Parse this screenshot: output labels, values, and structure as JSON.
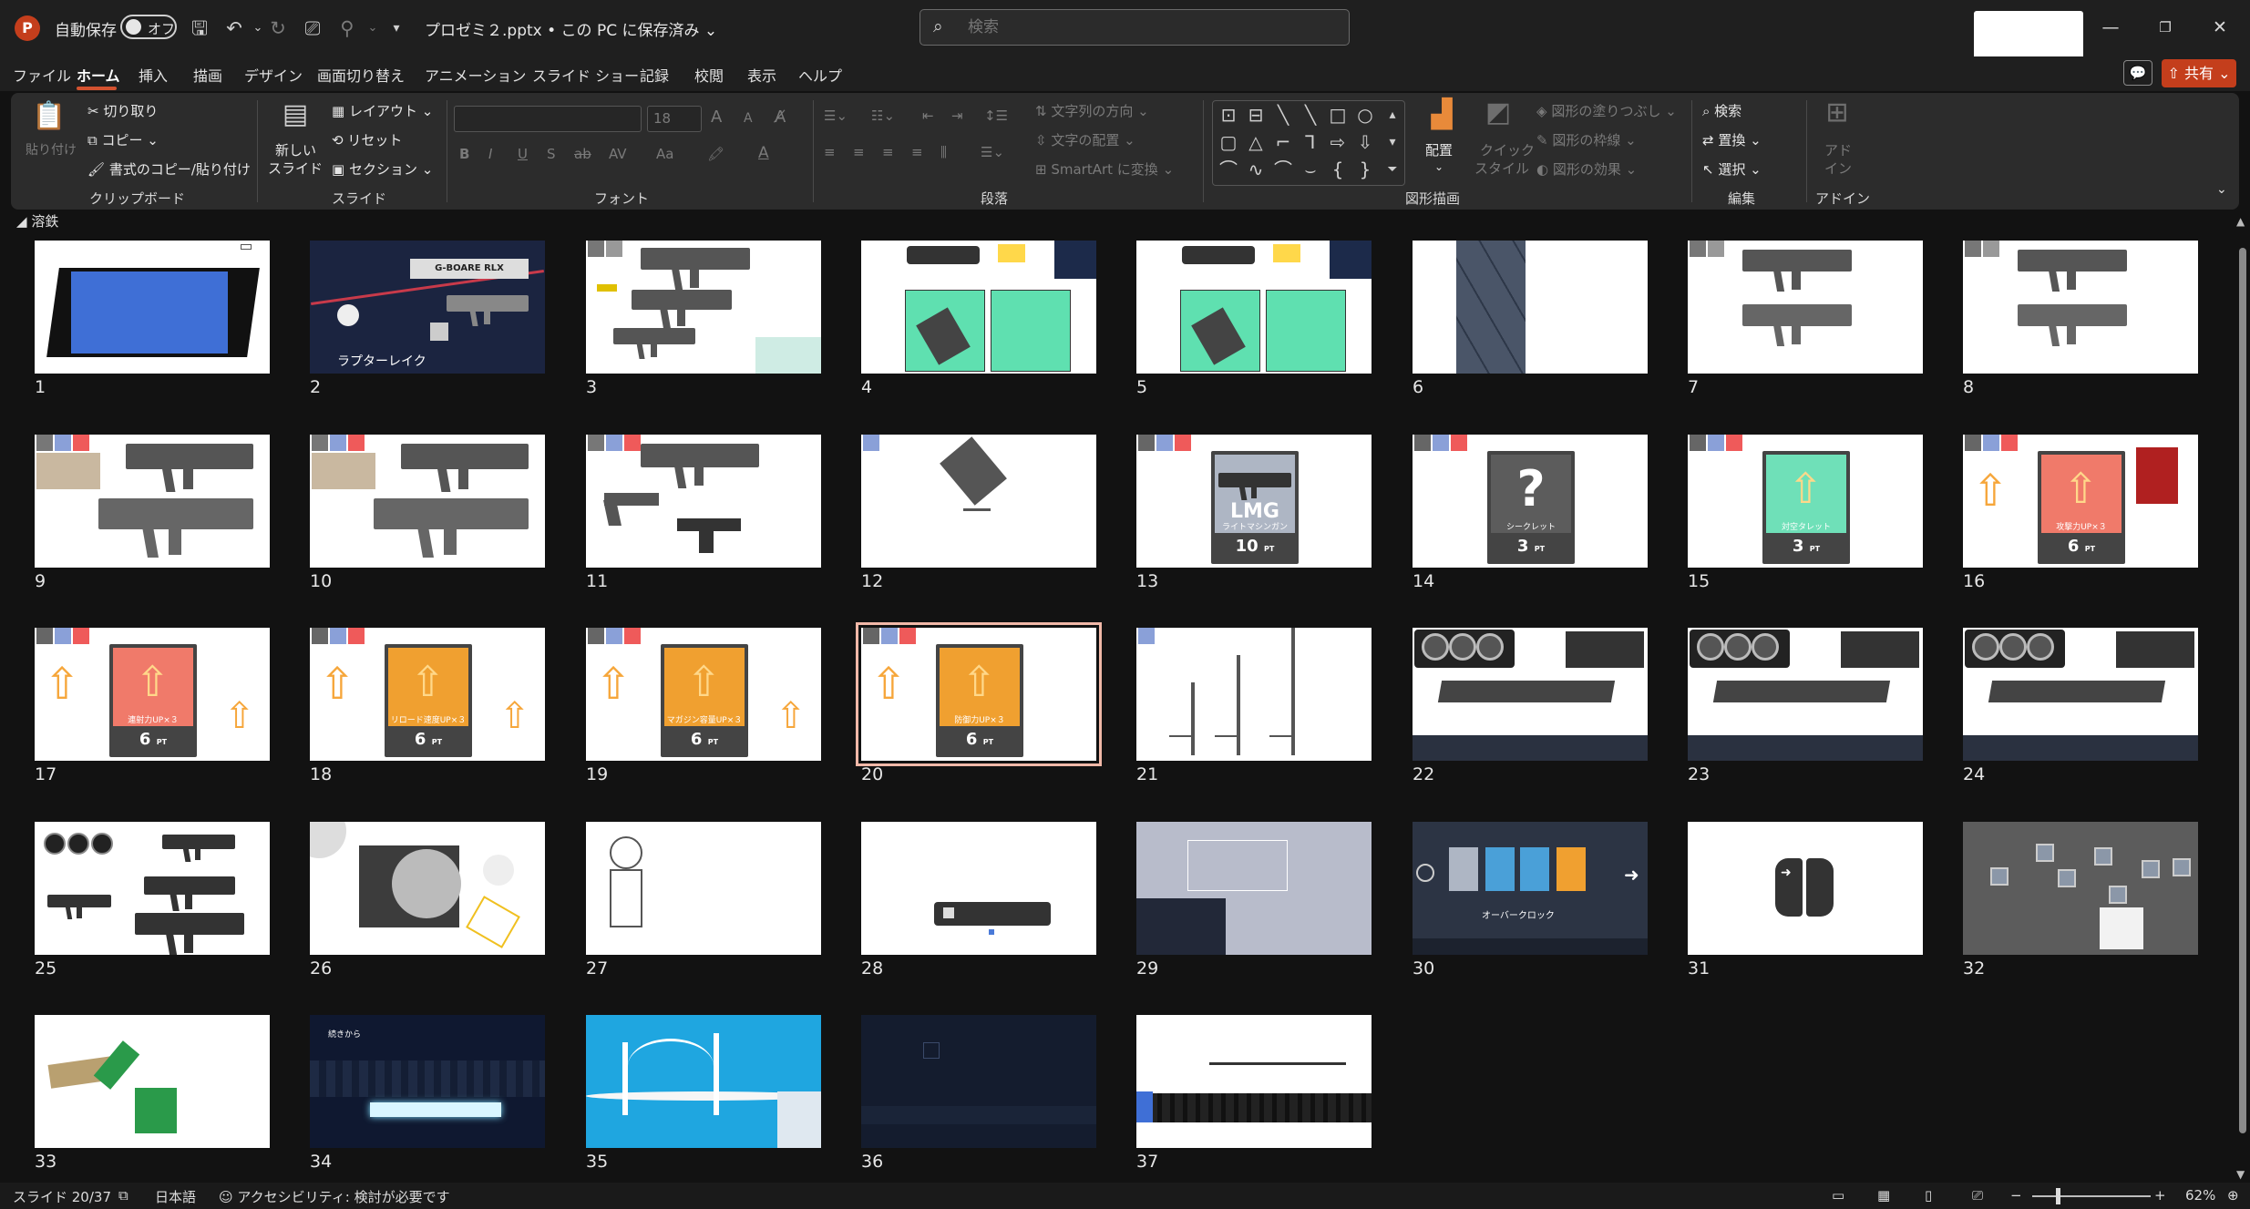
{
  "titlebar": {
    "app_icon": "P",
    "autosave_label": "自動保存",
    "autosave_state": "オフ",
    "doc_title": "プロゼミ２.pptx • この PC に保存済み ⌄",
    "search_placeholder": "検索",
    "icons": [
      "save-icon",
      "undo-icon",
      "redo-icon",
      "present-icon",
      "format-painter-icon"
    ]
  },
  "menu": {
    "tabs": [
      "ファイル",
      "ホーム",
      "挿入",
      "描画",
      "デザイン",
      "画面切り替え",
      "アニメーション",
      "スライド ショー",
      "記録",
      "校閲",
      "表示",
      "ヘルプ"
    ],
    "active_index": 1,
    "share_label": "共有"
  },
  "ribbon": {
    "clipboard": {
      "paste": "貼り付け",
      "cut": "切り取り",
      "copy": "コピー",
      "format_painter": "書式のコピー/貼り付け",
      "group": "クリップボード"
    },
    "slides": {
      "new_slide_1": "新しい",
      "new_slide_2": "スライド",
      "layout": "レイアウト",
      "reset": "リセット",
      "section": "セクション",
      "group": "スライド"
    },
    "font": {
      "size": "18",
      "bold": "B",
      "italic": "I",
      "underline": "U",
      "shadow": "S",
      "strike": "ab",
      "spacing": "AV",
      "case": "Aa",
      "grow": "A",
      "shrink": "A",
      "group": "フォント"
    },
    "paragraph": {
      "text_direction": "文字列の方向",
      "align_text": "文字の配置",
      "smartart": "SmartArt に変換",
      "group": "段落"
    },
    "drawing": {
      "arrange_1": "配置",
      "quick_styles_1": "クイック",
      "quick_styles_2": "スタイル",
      "fill": "図形の塗りつぶし",
      "outline": "図形の枠線",
      "effects": "図形の効果",
      "group": "図形描画"
    },
    "editing": {
      "find": "検索",
      "replace": "置換",
      "select": "選択",
      "group": "編集"
    },
    "addins": {
      "label_1": "アド",
      "label_2": "イン",
      "group": "アドイン"
    }
  },
  "section_name": "溶鉄",
  "slides": [
    {
      "n": "1",
      "kind": "blue-panel"
    },
    {
      "n": "2",
      "kind": "dark-title",
      "text": "ラプターレイク",
      "brand": "G-BOARE RLX"
    },
    {
      "n": "3",
      "kind": "rifles"
    },
    {
      "n": "4",
      "kind": "turret-cards"
    },
    {
      "n": "5",
      "kind": "turret-cards"
    },
    {
      "n": "6",
      "kind": "girder"
    },
    {
      "n": "7",
      "kind": "rifle-smg"
    },
    {
      "n": "8",
      "kind": "rifle-smg"
    },
    {
      "n": "9",
      "kind": "guns-photo"
    },
    {
      "n": "10",
      "kind": "guns-photo"
    },
    {
      "n": "11",
      "kind": "pistols"
    },
    {
      "n": "12",
      "kind": "turret"
    },
    {
      "n": "13",
      "kind": "card",
      "card_color": "#aeb6c4",
      "card_title": "LMG",
      "card_sub": "ライトマシンガン",
      "cost": "10",
      "unit": "PT"
    },
    {
      "n": "14",
      "kind": "card",
      "card_color": "#5c5c5c",
      "card_title": "?",
      "card_sub": "シークレット",
      "cost": "3",
      "unit": "PT"
    },
    {
      "n": "15",
      "kind": "card",
      "card_color": "#6fe0b8",
      "card_title": "",
      "card_sub": "対空タレット",
      "cost": "3",
      "unit": "PT"
    },
    {
      "n": "16",
      "kind": "card",
      "card_color": "#f07a6a",
      "card_title": "",
      "card_sub": "攻撃力UP×３",
      "cost": "6",
      "unit": "PT"
    },
    {
      "n": "17",
      "kind": "card",
      "card_color": "#f07a6a",
      "card_title": "",
      "card_sub": "連射力UP×３",
      "cost": "6",
      "unit": "PT"
    },
    {
      "n": "18",
      "kind": "card",
      "card_color": "#f0a030",
      "card_title": "",
      "card_sub": "リロード速度UP×３",
      "cost": "6",
      "unit": "PT"
    },
    {
      "n": "19",
      "kind": "card",
      "card_color": "#f0a030",
      "card_title": "",
      "card_sub": "マガジン容量UP×３",
      "cost": "6",
      "unit": "PT"
    },
    {
      "n": "20",
      "kind": "card",
      "card_color": "#f0a030",
      "card_title": "",
      "card_sub": "防御力UP×３",
      "cost": "6",
      "unit": "PT"
    },
    {
      "n": "21",
      "kind": "stands"
    },
    {
      "n": "22",
      "kind": "gpu"
    },
    {
      "n": "23",
      "kind": "gpu"
    },
    {
      "n": "24",
      "kind": "gpu"
    },
    {
      "n": "25",
      "kind": "gpu-guns"
    },
    {
      "n": "26",
      "kind": "machine"
    },
    {
      "n": "27",
      "kind": "figure"
    },
    {
      "n": "28",
      "kind": "bar"
    },
    {
      "n": "29",
      "kind": "ui-gray"
    },
    {
      "n": "30",
      "kind": "ui-shop",
      "caption": "オーバークロック"
    },
    {
      "n": "31",
      "kind": "switch"
    },
    {
      "n": "32",
      "kind": "chips"
    },
    {
      "n": "33",
      "kind": "ram"
    },
    {
      "n": "34",
      "kind": "night",
      "caption": "続きから"
    },
    {
      "n": "35",
      "kind": "bridge"
    },
    {
      "n": "36",
      "kind": "dark-blue"
    },
    {
      "n": "37",
      "kind": "skyline"
    }
  ],
  "selected_slide": "20",
  "status": {
    "slide_info": "スライド 20/37",
    "language": "日本語",
    "accessibility": "アクセシビリティ: 検討が必要です",
    "zoom": "62%"
  },
  "colors": {
    "accent": "#d35230",
    "share": "#c43e1c",
    "selection_outline": "#f1b8a8"
  }
}
